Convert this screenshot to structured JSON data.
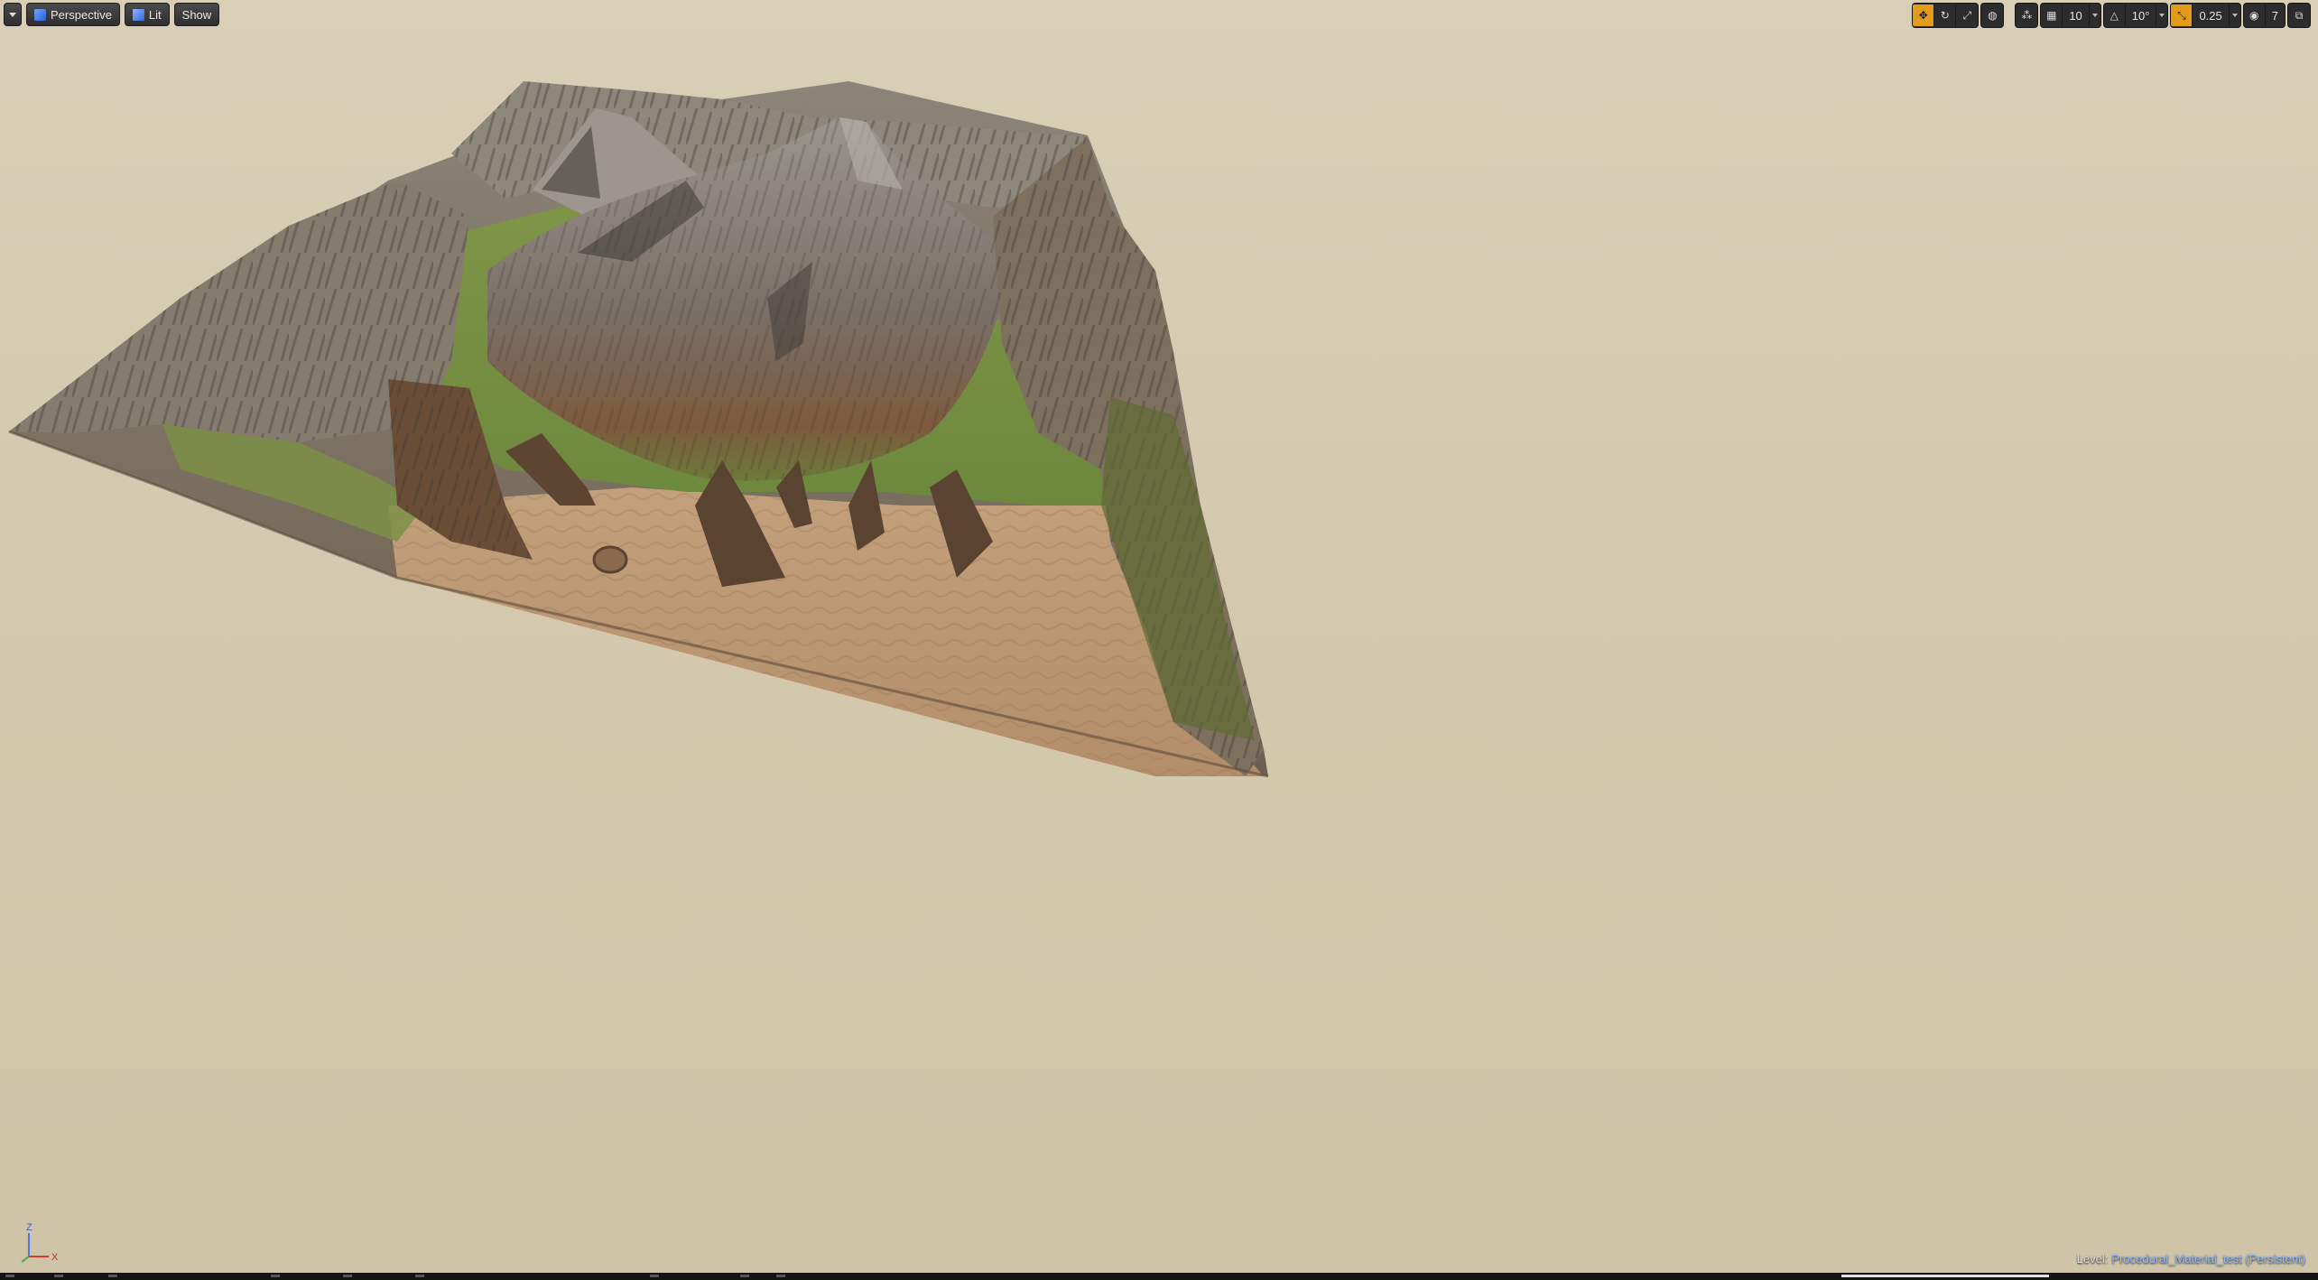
{
  "toolbar_left": {
    "perspective_label": "Perspective",
    "lit_label": "Lit",
    "show_label": "Show"
  },
  "toolbar_right": {
    "grid_snap_value": "10",
    "rotation_snap_value": "10°",
    "scale_snap_value": "0.25",
    "camera_speed_value": "7",
    "accent_color": "#e39b1a"
  },
  "axis_gizmo": {
    "z_label": "Z",
    "x_label": "X"
  },
  "status": {
    "level_label": "Level:",
    "level_name": "Procedural_Material_test (Persistent)"
  },
  "colors": {
    "background": "#d6ccb3",
    "toolbar_button": "#333333",
    "level_name": "#8fb8ff"
  }
}
